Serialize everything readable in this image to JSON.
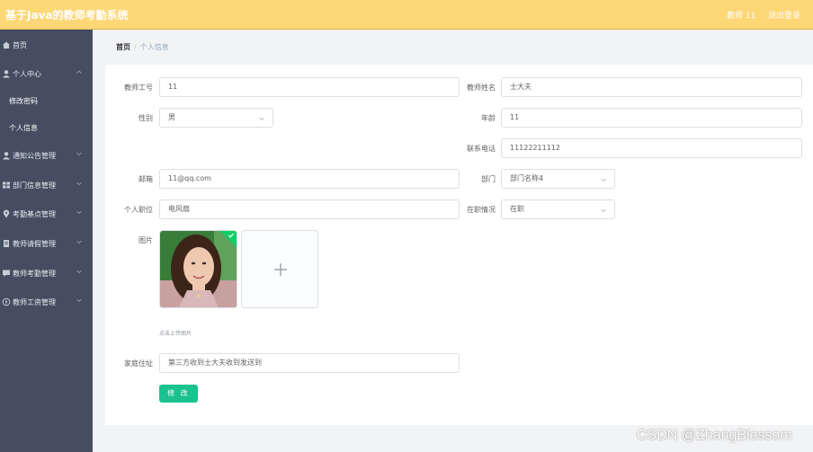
{
  "header": {
    "title": "基于Java的教师考勤系统",
    "user": "教师 11",
    "logout": "退出登录"
  },
  "sidebar": {
    "items": [
      {
        "label": "首页",
        "icon": "home-icon"
      },
      {
        "label": "个人中心",
        "icon": "user-icon",
        "expanded": true,
        "children": [
          {
            "label": "修改密码"
          },
          {
            "label": "个人信息"
          }
        ]
      },
      {
        "label": "通知公告管理",
        "icon": "user-icon"
      },
      {
        "label": "部门信息管理",
        "icon": "grid-icon"
      },
      {
        "label": "考勤基点管理",
        "icon": "location-icon"
      },
      {
        "label": "教师请假管理",
        "icon": "document-icon"
      },
      {
        "label": "教师考勤管理",
        "icon": "message-icon"
      },
      {
        "label": "教师工资管理",
        "icon": "compass-icon"
      }
    ]
  },
  "breadcrumb": {
    "home": "首页",
    "separator": "/",
    "current": "个人信息"
  },
  "form": {
    "teacher_no": {
      "label": "教师工号",
      "value": "11"
    },
    "teacher_name": {
      "label": "教师姓名",
      "value": "士大夫"
    },
    "gender": {
      "label": "性别",
      "value": "男"
    },
    "age": {
      "label": "年龄",
      "value": "11"
    },
    "phone": {
      "label": "联系电话",
      "value": "11122211112"
    },
    "email": {
      "label": "邮箱",
      "value": "11@qq.com"
    },
    "department": {
      "label": "部门",
      "value": "部门名称4"
    },
    "position": {
      "label": "个人职位",
      "value": "电风扇"
    },
    "employment": {
      "label": "在职情况",
      "value": "在职"
    },
    "photo": {
      "label": "图片",
      "upload_tip": "点击上传图片"
    },
    "address": {
      "label": "家庭住址",
      "value": "第三方收到士大夫收到发送到"
    },
    "submit": "修 改"
  },
  "watermark": "CSDN @ZhangBlossom",
  "colors": {
    "header_bg": "#fdd776",
    "sidebar_bg": "#454e60",
    "primary_button": "#19c28e"
  }
}
